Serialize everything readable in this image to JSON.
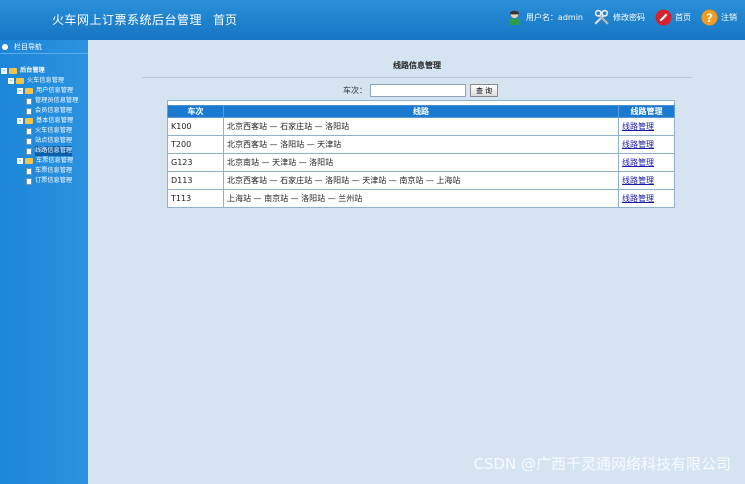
{
  "header": {
    "app_title": "火车网上订票系统后台管理",
    "home": "首页",
    "user_label": "用户名：admin",
    "change_password": "修改密码",
    "home_link": "首页",
    "logout": "注销"
  },
  "sidebar": {
    "title": "栏目导航",
    "tree": [
      {
        "label": "后台管理",
        "level": 0
      },
      {
        "label": "火车信息管理",
        "level": 1
      },
      {
        "label": "用户信息管理",
        "level": 2
      },
      {
        "label": "管理员信息管理",
        "level": 3
      },
      {
        "label": "会员信息管理",
        "level": 3
      },
      {
        "label": "基本信息管理",
        "level": 2
      },
      {
        "label": "火车信息管理",
        "level": 3
      },
      {
        "label": "站点信息管理",
        "level": 3
      },
      {
        "label": "线路信息管理",
        "level": 3
      },
      {
        "label": "车票信息管理",
        "level": 2
      },
      {
        "label": "车票信息管理",
        "level": 3
      },
      {
        "label": "订票信息管理",
        "level": 3
      }
    ]
  },
  "main": {
    "page_title": "线路信息管理",
    "search_label": "车次：",
    "search_value": "",
    "search_button": "查 询",
    "columns": [
      "车次",
      "线路",
      "线路管理"
    ],
    "rows": [
      {
        "train": "K100",
        "route": "北京西客站 — 石家庄站 — 洛阳站",
        "action": "线路管理"
      },
      {
        "train": "T200",
        "route": "北京西客站 — 洛阳站 — 天津站",
        "action": "线路管理"
      },
      {
        "train": "G123",
        "route": "北京南站 — 天津站 — 洛阳站",
        "action": "线路管理"
      },
      {
        "train": "D113",
        "route": "北京西客站 — 石家庄站 — 洛阳站 — 天津站 — 南京站 — 上海站",
        "action": "线路管理"
      },
      {
        "train": "T113",
        "route": "上海站 — 南京站 — 洛阳站 — 兰州站",
        "action": "线路管理"
      }
    ]
  },
  "watermark": "CSDN @广西千灵通网络科技有限公司"
}
